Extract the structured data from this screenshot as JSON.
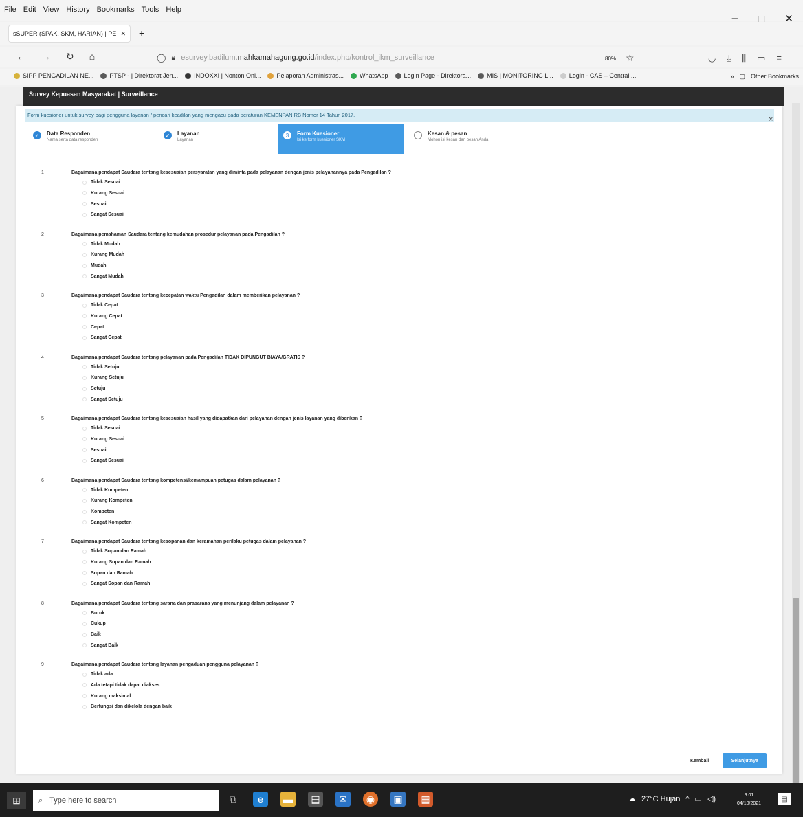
{
  "menu": [
    "File",
    "Edit",
    "View",
    "History",
    "Bookmarks",
    "Tools",
    "Help"
  ],
  "window_controls": {
    "minimize": "–",
    "maximize": "◻",
    "close": "✕"
  },
  "tab": {
    "title": "sSUPER (SPAK, SKM, HARIAN) | PEI",
    "close": "✕",
    "new_tab": "+"
  },
  "nav": {
    "back": "←",
    "forward": "→",
    "reload": "↻",
    "home": "⌂",
    "url_prefix": "esurvey.badilum.",
    "url_domain": "mahkamahagung.go.id",
    "url_path": "/index.php/kontrol_ikm_surveillance",
    "zoom": "80%"
  },
  "bookmarks": [
    {
      "label": "SIPP PENGADILAN NE...",
      "color": "#d6b23b"
    },
    {
      "label": "PTSP - | Direktorat Jen...",
      "color": "#5a5a5a"
    },
    {
      "label": "INDOXXI | Nonton Onl...",
      "color": "#333333"
    },
    {
      "label": "Pelaporan Administras...",
      "color": "#e0a23c"
    },
    {
      "label": "WhatsApp",
      "color": "#2fa84f"
    },
    {
      "label": "Login Page - Direktora...",
      "color": "#5a5a5a"
    },
    {
      "label": "MIS | MONITORING L...",
      "color": "#5a5a5a"
    },
    {
      "label": "Login - CAS – Central ...",
      "color": "#cccccc"
    }
  ],
  "bookmarks_more": "»",
  "other_bookmarks": "Other Bookmarks",
  "page_header": "Survey Kepuasan Masyarakat | Surveillance",
  "notice": "Form kuesioner untuk survey bagi pengguna layanan / pencari keadilan yang mengacu pada peraturan KEMENPAN RB Nomor 14 Tahun 2017.",
  "close_label": "×",
  "steps": [
    {
      "title": "Data Responden",
      "sub": "Nama serta data responden",
      "state": "done",
      "mark": "✓"
    },
    {
      "title": "Layanan",
      "sub": "Layanan",
      "state": "done",
      "mark": "✓"
    },
    {
      "title": "Form Kuesioner",
      "sub": "Isi ke form kuesioner SKM",
      "state": "active",
      "mark": "3"
    },
    {
      "title": "Kesan & pesan",
      "sub": "Mohon isi kesan dan pesan Anda",
      "state": "pending",
      "mark": ""
    }
  ],
  "questions": [
    {
      "num": "1",
      "text": "Bagaimana pendapat Saudara tentang kesesuaian persyaratan yang diminta pada pelayanan dengan jenis pelayanannya pada Pengadilan ?",
      "options": [
        "Tidak Sesuai",
        "Kurang Sesuai",
        "Sesuai",
        "Sangat Sesuai"
      ]
    },
    {
      "num": "2",
      "text": "Bagaimana pemahaman Saudara tentang kemudahan prosedur pelayanan pada Pengadilan ?",
      "options": [
        "Tidak Mudah",
        "Kurang Mudah",
        "Mudah",
        "Sangat Mudah"
      ]
    },
    {
      "num": "3",
      "text": "Bagaimana pendapat Saudara tentang kecepatan waktu Pengadilan dalam memberikan pelayanan ?",
      "options": [
        "Tidak Cepat",
        "Kurang Cepat",
        "Cepat",
        "Sangat Cepat"
      ]
    },
    {
      "num": "4",
      "text": "Bagaimana pendapat Saudara tentang pelayanan pada Pengadilan TIDAK DIPUNGUT BIAYA/GRATIS ?",
      "options": [
        "Tidak Setuju",
        "Kurang Setuju",
        "Setuju",
        "Sangat Setuju"
      ]
    },
    {
      "num": "5",
      "text": "Bagaimana pendapat Saudara tentang kesesuaian hasil yang didapatkan dari pelayanan dengan jenis layanan yang diberikan ?",
      "options": [
        "Tidak Sesuai",
        "Kurang Sesuai",
        "Sesuai",
        "Sangat Sesuai"
      ]
    },
    {
      "num": "6",
      "text": "Bagaimana pendapat Saudara tentang kompetensi/kemampuan petugas dalam pelayanan ?",
      "options": [
        "Tidak Kompeten",
        "Kurang Kompeten",
        "Kompeten",
        "Sangat Kompeten"
      ]
    },
    {
      "num": "7",
      "text": "Bagaimana pendapat Saudara tentang kesopanan dan keramahan perilaku petugas dalam pelayanan ?",
      "options": [
        "Tidak Sopan dan Ramah",
        "Kurang Sopan dan Ramah",
        "Sopan dan Ramah",
        "Sangat Sopan dan Ramah"
      ]
    },
    {
      "num": "8",
      "text": "Bagaimana pendapat Saudara tentang sarana dan prasarana yang menunjang dalam pelayanan ?",
      "options": [
        "Buruk",
        "Cukup",
        "Baik",
        "Sangat Baik"
      ]
    },
    {
      "num": "9",
      "text": "Bagaimana pendapat Saudara tentang layanan pengaduan pengguna pelayanan ?",
      "options": [
        "Tidak ada",
        "Ada tetapi tidak dapat diakses",
        "Kurang maksimal",
        "Berfungsi dan dikelola dengan baik"
      ]
    }
  ],
  "buttons": {
    "back": "Kembali",
    "next": "Selanjutnya"
  },
  "taskbar": {
    "search_placeholder": "Type here to search",
    "weather": "27°C Hujan",
    "time": "9:01",
    "date": "04/10/2021"
  },
  "colors": {
    "accent": "#3f9be4",
    "notice_bg": "#d6ecf5",
    "header_bg": "#2c2c2c"
  }
}
